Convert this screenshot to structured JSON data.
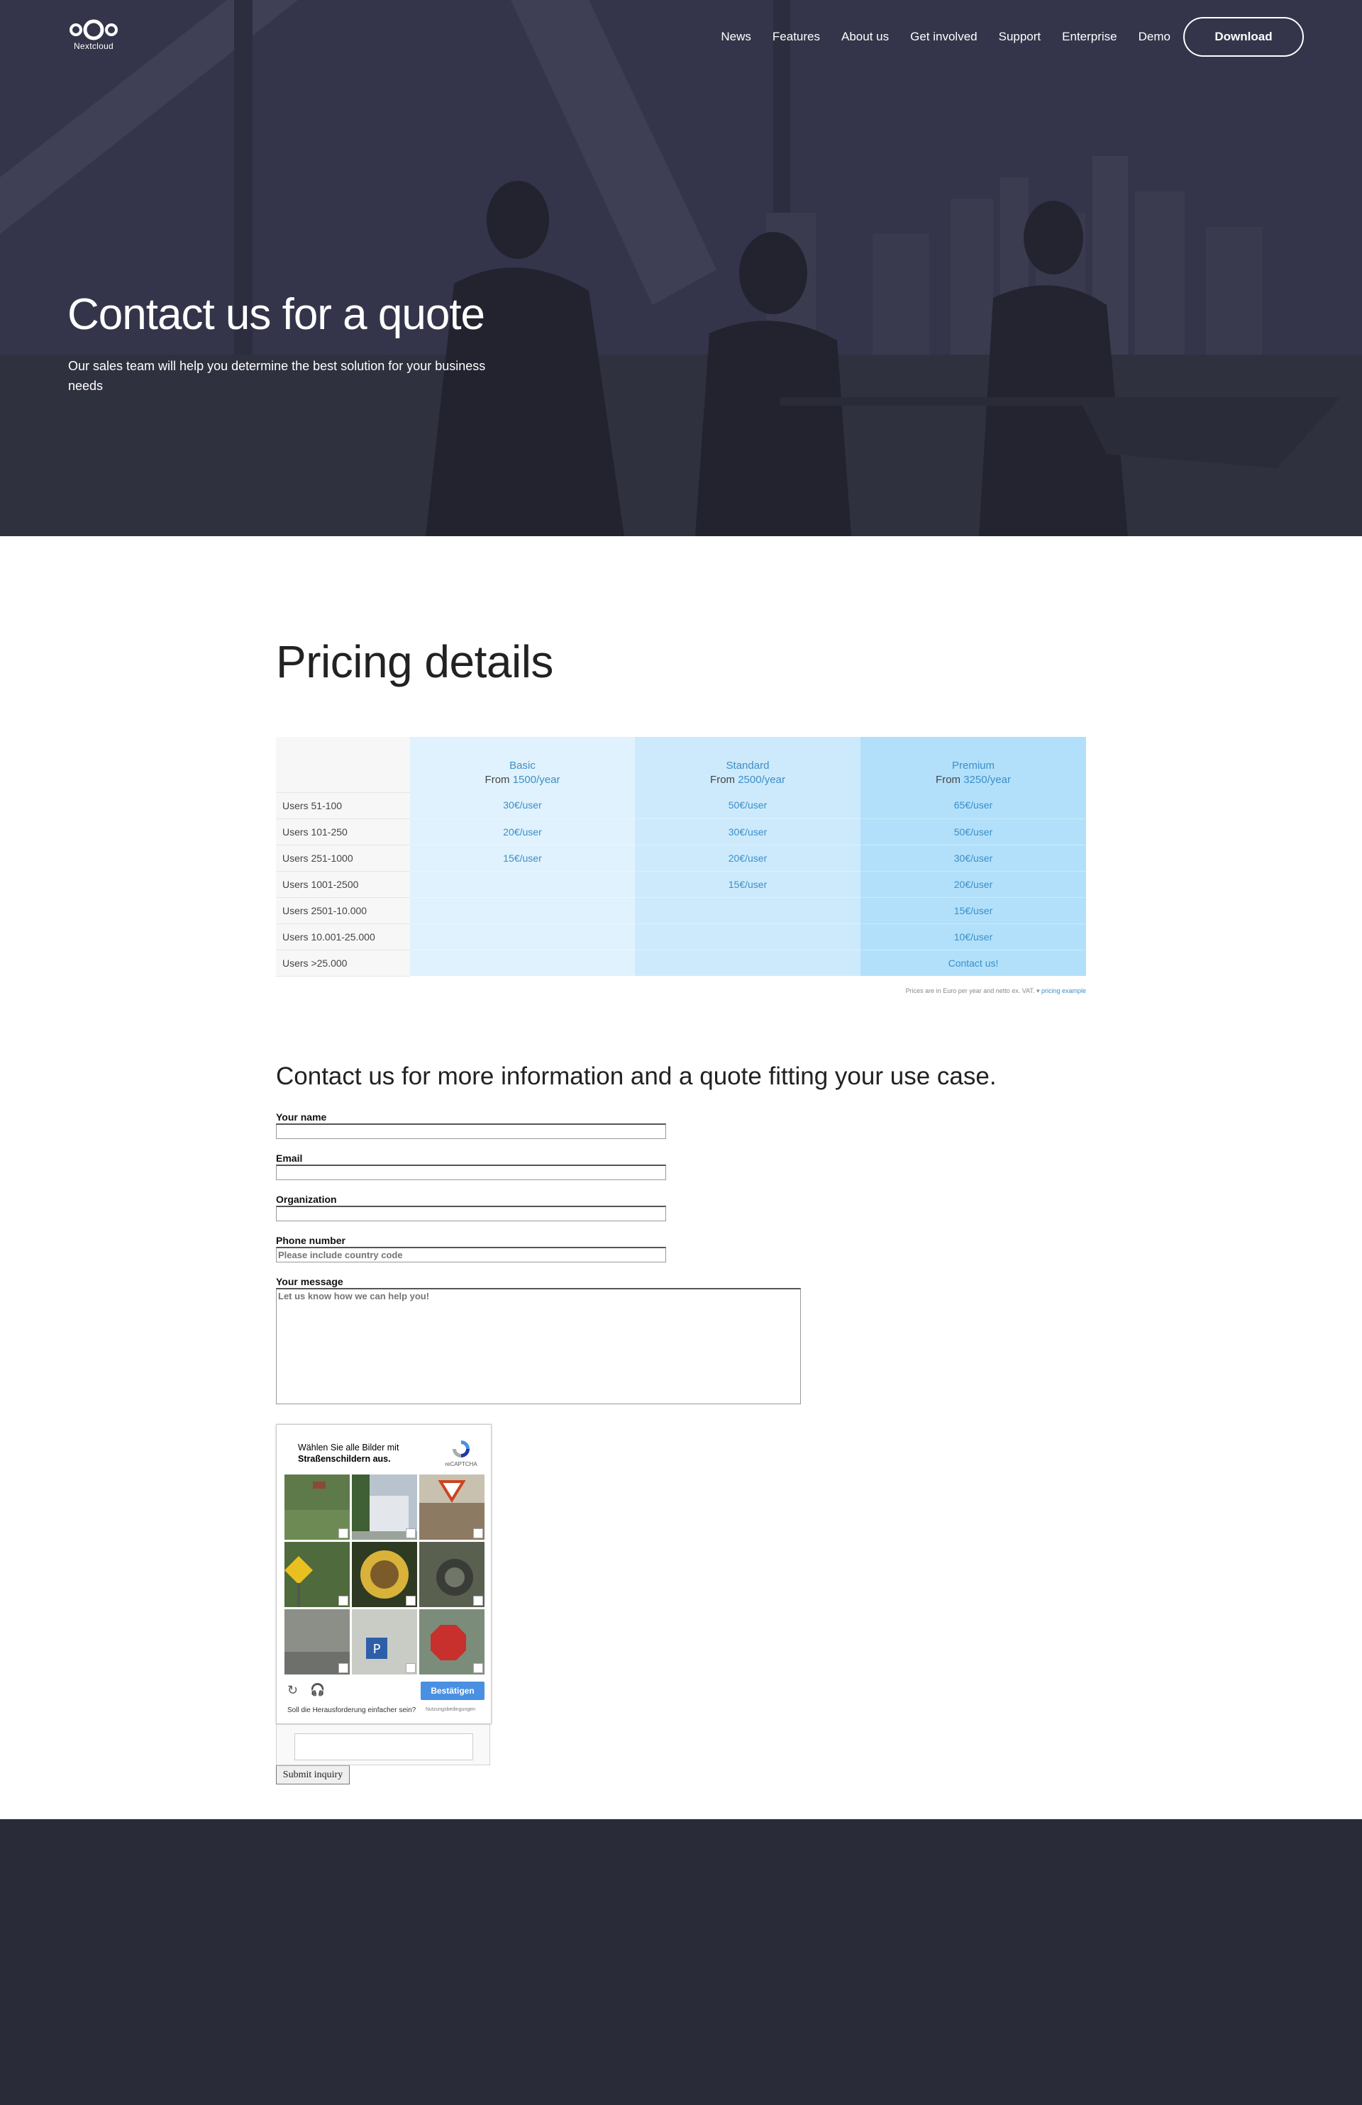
{
  "brand": {
    "logo_text": "Nextcloud"
  },
  "nav": {
    "items": [
      "News",
      "Features",
      "About us",
      "Get involved",
      "Support",
      "Enterprise",
      "Demo"
    ],
    "download_label": "Download"
  },
  "hero": {
    "title": "Contact us for a quote",
    "subtitle": "Our sales team will help you determine the best solution for your business needs"
  },
  "pricing": {
    "title": "Pricing details",
    "plans": [
      {
        "name": "Basic",
        "from_label": "From ",
        "price": "1500/year"
      },
      {
        "name": "Standard",
        "from_label": "From ",
        "price": "2500/year"
      },
      {
        "name": "Premium",
        "from_label": "From ",
        "price": "3250/year"
      }
    ],
    "rows": [
      {
        "label": "Users 51-100",
        "basic": "30€/user",
        "standard": "50€/user",
        "premium": "65€/user"
      },
      {
        "label": "Users 101-250",
        "basic": "20€/user",
        "standard": "30€/user",
        "premium": "50€/user"
      },
      {
        "label": "Users 251-1000",
        "basic": "15€/user",
        "standard": "20€/user",
        "premium": "30€/user"
      },
      {
        "label": "Users 1001-2500",
        "basic": "",
        "standard": "15€/user",
        "premium": "20€/user"
      },
      {
        "label": "Users 2501-10.000",
        "basic": "",
        "standard": "",
        "premium": "15€/user"
      },
      {
        "label": "Users 10.001-25.000",
        "basic": "",
        "standard": "",
        "premium": "10€/user"
      },
      {
        "label": "Users >25.000",
        "basic": "",
        "standard": "",
        "premium": "Contact us!"
      }
    ],
    "note": "Prices are in Euro per year and netto ex. VAT. ",
    "note_link": "pricing example"
  },
  "contact": {
    "title": "Contact us for more information and a quote fitting your use case.",
    "fields": {
      "name_label": "Your name",
      "email_label": "Email",
      "org_label": "Organization",
      "phone_label": "Phone number",
      "phone_placeholder": "Please include country code",
      "message_label": "Your message",
      "message_placeholder": "Let us know how we can help you!"
    },
    "submit_label": "Submit inquiry"
  },
  "captcha": {
    "instruction_prefix": "Wählen Sie alle Bilder mit",
    "instruction_target": "Straßenschildern aus.",
    "brand": "reCAPTCHA",
    "confirm_label": "Bestätigen",
    "easier_label": "Soll die Herausforderung einfacher sein?",
    "terms_label": "Nutzungsbedingungen"
  },
  "colors": {
    "hero_bg": "#33344a",
    "footer_bg": "#2a2b39",
    "plan_basic": "#e0f2fd",
    "plan_standard": "#cdeafc",
    "plan_premium": "#b2e0fb",
    "accent": "#3c8fc7",
    "captcha_button": "#4a90e2"
  }
}
